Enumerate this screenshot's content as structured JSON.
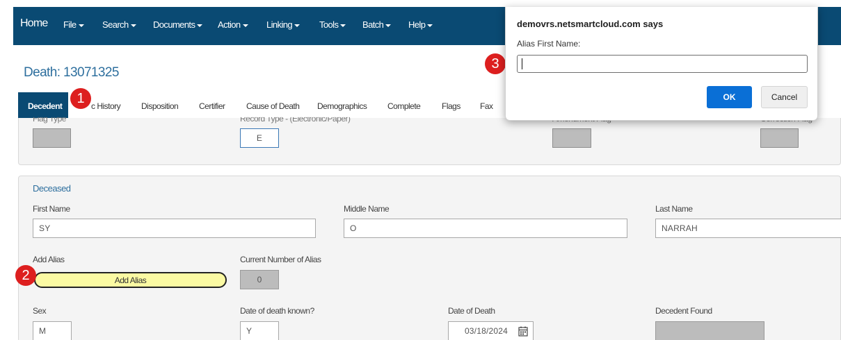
{
  "nav": {
    "home": "Home",
    "items": [
      "File",
      "Search",
      "Documents",
      "Action",
      "Linking",
      "Tools",
      "Batch",
      "Help"
    ]
  },
  "record": {
    "title": "Death: 13071325"
  },
  "tabs": [
    "Decedent",
    "c History",
    "Disposition",
    "Certifier",
    "Cause of Death",
    "Demographics",
    "Complete",
    "Flags",
    "Fax"
  ],
  "top_section": {
    "flag_type_label": "Flag Type",
    "record_type_label": "Record Type - (Electronic/Paper)",
    "record_type_value": "E",
    "amendment_flag_label": "Amendment Flag",
    "correction_flag_label": "Correction Flag"
  },
  "deceased": {
    "section_title": "Deceased",
    "first_name_label": "First Name",
    "first_name_value": "SY",
    "middle_name_label": "Middle Name",
    "middle_name_value": "O",
    "last_name_label": "Last Name",
    "last_name_value": "NARRAH",
    "add_alias_label": "Add Alias",
    "add_alias_button": "Add Alias",
    "alias_count_label": "Current Number of Alias",
    "alias_count_value": "0",
    "sex_label": "Sex",
    "sex_value": "M",
    "dod_known_label": "Date of death known?",
    "dod_known_value": "Y",
    "dod_label": "Date of Death",
    "dod_value": "03/18/2024",
    "decedent_found_label": "Decedent Found"
  },
  "badges": [
    "1",
    "2",
    "3"
  ],
  "dialog": {
    "title": "demovrs.netsmartcloud.com says",
    "message": "Alias First Name:",
    "input_value": "",
    "ok_label": "OK",
    "cancel_label": "Cancel"
  },
  "colors": {
    "nav_bg": "#0a4a73",
    "accent_blue": "#2e6f9e",
    "ok_blue": "#0a6fd6",
    "badge_red": "#dd1f1f",
    "alias_button_yellow": "#fbfaa3"
  }
}
